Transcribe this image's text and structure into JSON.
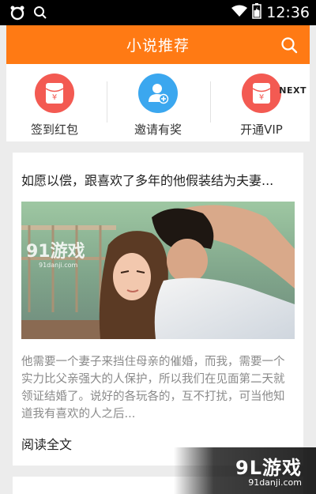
{
  "status_bar": {
    "time": "12:36"
  },
  "header": {
    "title": "小说推荐"
  },
  "quick_actions": {
    "items": [
      {
        "label": "签到红包",
        "icon": "red-envelope-icon",
        "color": "#f35a52"
      },
      {
        "label": "邀请有奖",
        "icon": "add-user-icon",
        "color": "#3ba7ef"
      },
      {
        "label": "开通VIP",
        "icon": "red-envelope-icon",
        "color": "#f35a52"
      }
    ],
    "next_label": "NEXT"
  },
  "card": {
    "title": "如愿以偿，跟喜欢了多年的他假装结为夫妻...",
    "image_watermark": "91游戏",
    "image_watermark_sub": "91danji.com",
    "excerpt": "他需要一个妻子来挡住母亲的催婚，而我，需要一个实力比父亲强大的人保护，所以我们在见面第二天就领证结婚了。说好的各玩各的，互不打扰，可当他知道我有喜欢的人之后...",
    "read_more": "阅读全文"
  },
  "watermark": {
    "main": "9L游戏",
    "sub": "91danji.com"
  },
  "colors": {
    "accent": "#ff7a14",
    "red": "#f35a52",
    "blue": "#3ba7ef"
  }
}
